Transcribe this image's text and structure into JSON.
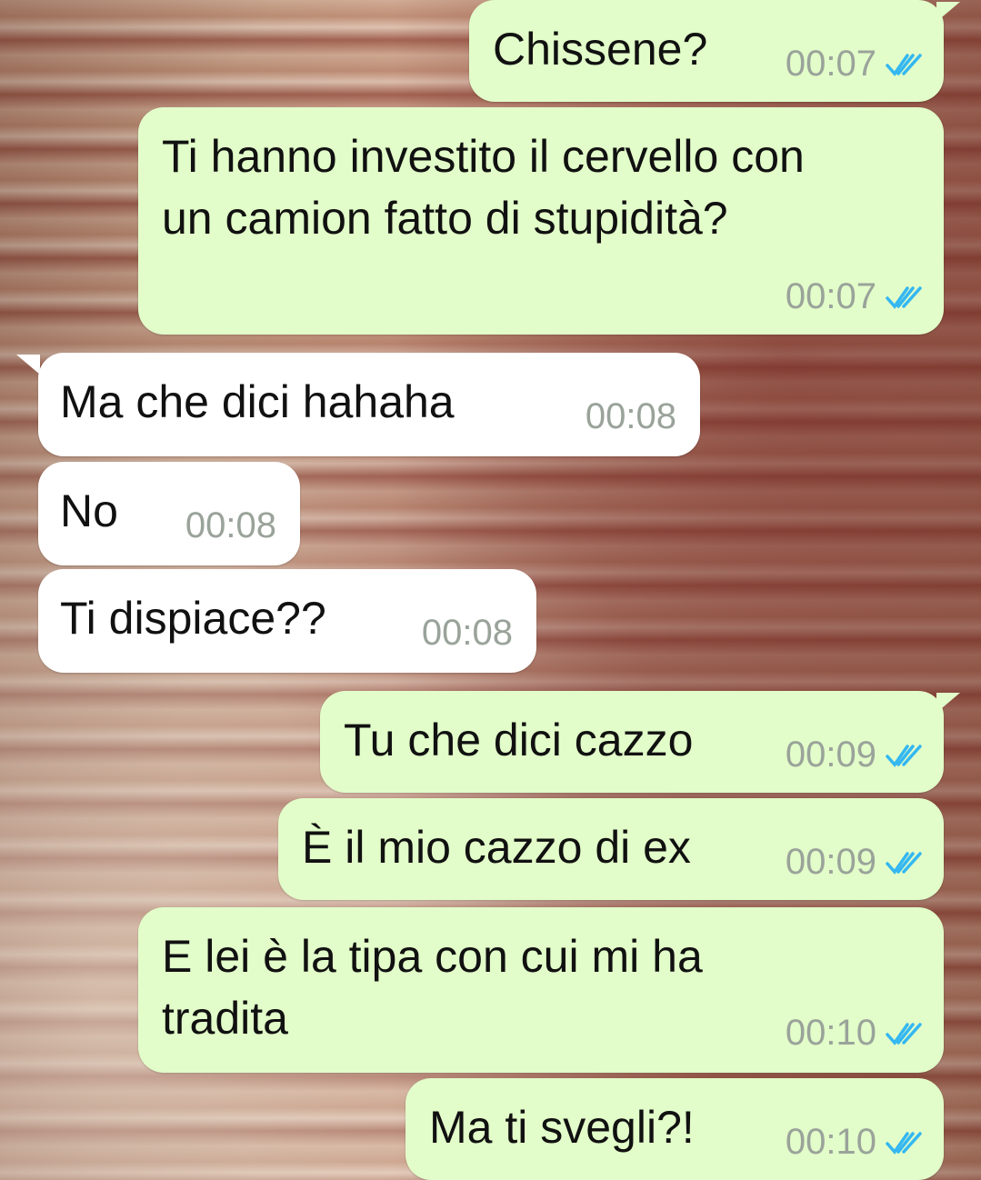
{
  "messages": [
    {
      "direction": "outgoing",
      "text": "Chissene?",
      "time": "00:07",
      "status": "read"
    },
    {
      "direction": "outgoing",
      "text": "Ti hanno investito il cervello con\nun camion fatto di stupidità?",
      "time": "00:07",
      "status": "read"
    },
    {
      "direction": "incoming",
      "text": "Ma che dici hahaha",
      "time": "00:08"
    },
    {
      "direction": "incoming",
      "text": "No",
      "time": "00:08"
    },
    {
      "direction": "incoming",
      "text": "Ti dispiace??",
      "time": "00:08"
    },
    {
      "direction": "outgoing",
      "text": "Tu che dici cazzo",
      "time": "00:09",
      "status": "read"
    },
    {
      "direction": "outgoing",
      "text": "È il mio cazzo di ex",
      "time": "00:09",
      "status": "read"
    },
    {
      "direction": "outgoing",
      "text": "E lei è la tipa con cui mi ha\ntradita",
      "time": "00:10",
      "status": "read"
    },
    {
      "direction": "outgoing",
      "text": "Ma ti svegli?!",
      "time": "00:10",
      "status": "read"
    }
  ],
  "colors": {
    "outgoing_bubble": "#e2fdc9",
    "incoming_bubble": "#ffffff",
    "read_tick": "#34b7f1",
    "time": "#9aa39a"
  },
  "icons": {
    "read_status": "double-check-icon"
  }
}
